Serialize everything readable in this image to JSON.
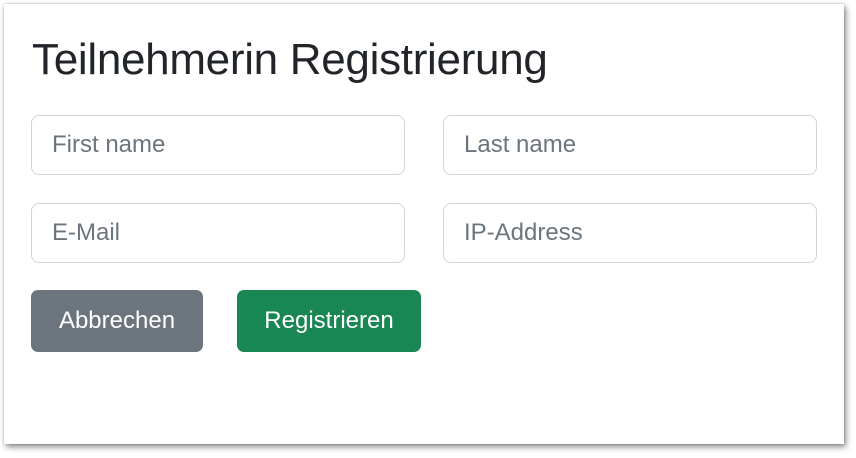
{
  "form": {
    "title": "Teilnehmerin Registrierung",
    "fields": {
      "first_name": {
        "placeholder": "First name",
        "value": ""
      },
      "last_name": {
        "placeholder": "Last name",
        "value": ""
      },
      "email": {
        "placeholder": "E-Mail",
        "value": ""
      },
      "ip_address": {
        "placeholder": "IP-Address",
        "value": ""
      }
    },
    "buttons": {
      "cancel_label": "Abbrechen",
      "register_label": "Registrieren"
    }
  },
  "colors": {
    "cancel_button": "#6c757d",
    "register_button": "#198754",
    "text": "#212529",
    "input_border": "#ced4da"
  }
}
